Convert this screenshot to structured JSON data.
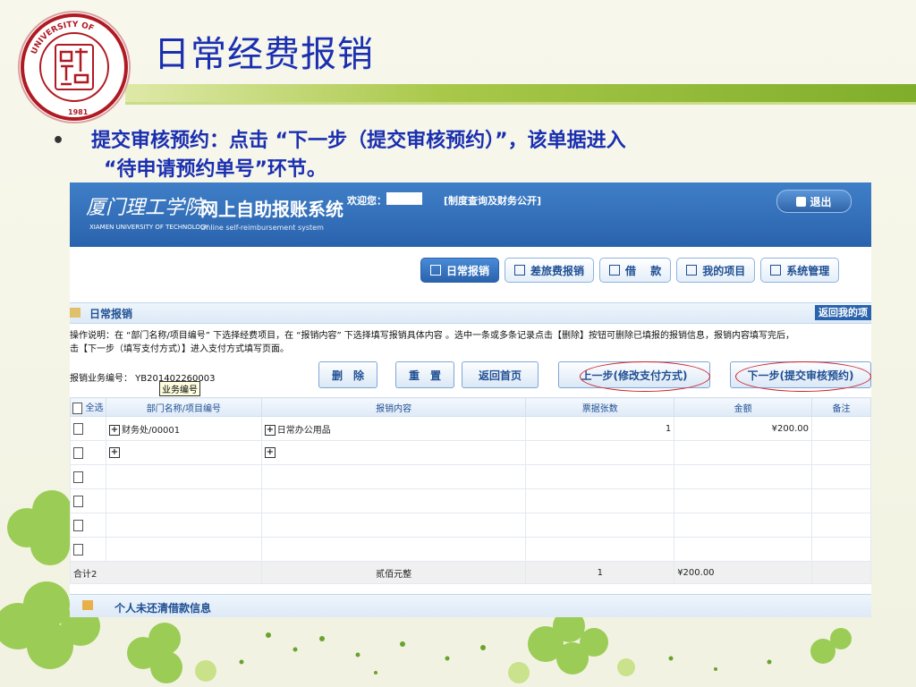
{
  "slide": {
    "title": "日常经费报销",
    "bullet_line1": "提交审核预约：点击 “下一步（提交审核预约）”，该单据进入",
    "bullet_line2": "“待申请预约单号”环节。",
    "bullet_dot": "•"
  },
  "logo": {
    "text_top": "UNIVERSITY OF",
    "text_left": "XIAMEN",
    "text_right": "TECHNOLOGY",
    "year": "1981"
  },
  "app": {
    "school_calligraphy": "厦门理工学院",
    "school_en": "XIAMEN UNIVERSITY OF TECHNOLOGY",
    "system_name": "网上自助报账系统",
    "system_sub": "Online self-reimbursement system",
    "welcome": "欢迎您：",
    "policy_link": "[制度查询及财务公开]",
    "logout": "退出"
  },
  "nav": {
    "tabs": [
      {
        "label": "日常报销",
        "active": true
      },
      {
        "label": "差旅费报销",
        "active": false
      },
      {
        "label": "借　 款",
        "active": false
      },
      {
        "label": "我的项目",
        "active": false
      },
      {
        "label": "系统管理",
        "active": false
      }
    ]
  },
  "section": {
    "title": "日常报销",
    "back": "返回我的项"
  },
  "instructions": {
    "line1": "操作说明：在 “部门名称/项目编号” 下选择经费项目，在 “报销内容” 下选择填写报销具体内容 。选中一条或多条记录点击【删除】按钮可删除已填报的报销信息，报销内容填写完后，",
    "line2": "击【下一步（填写支付方式）】进入支付方式填写页面。"
  },
  "form": {
    "biz_no": "报销业务编号： YB201402260003",
    "biz_tip": "业务编号",
    "btn_delete": "删　除",
    "btn_reset": "重　置",
    "btn_home": "返回首页",
    "btn_prev": "上一步(修改支付方式)",
    "btn_next": "下一步(提交审核预约)"
  },
  "table": {
    "headers": [
      "全选",
      "部门名称/项目编号",
      "报销内容",
      "票据张数",
      "金额",
      "备注"
    ],
    "rows": [
      {
        "dept": "财务处/00001",
        "content": "日常办公用品",
        "count": "1",
        "amount": "¥200.00",
        "note": ""
      }
    ],
    "total": {
      "label": "合计2",
      "amount_words": "贰佰元整",
      "count": "1",
      "amount": "¥200.00"
    }
  },
  "loan": {
    "title": "个人未还清借款信息"
  },
  "colors": {
    "title_blue": "#1a2fb0",
    "header_blue": "#2a63ad",
    "highlight_red": "#d0202a"
  }
}
